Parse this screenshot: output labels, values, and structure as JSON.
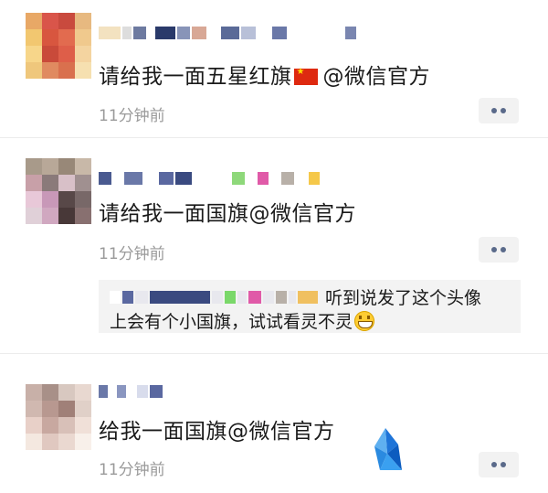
{
  "posts": [
    {
      "content": "请给我一面五星红旗",
      "mention": "@微信官方",
      "time": "11分钟前"
    },
    {
      "content": "请给我一面国旗@微信官方",
      "time": "11分钟前",
      "comment": {
        "line1": "听到说发了这个头像",
        "line2": "上会有个小国旗，试试看灵不灵"
      }
    },
    {
      "content": "给我一面国旗@微信官方",
      "time": "11分钟前"
    }
  ],
  "icons": {
    "flag": "china-flag-emoji",
    "grin": "grinning-face-emoji",
    "more": "more-dots-icon",
    "watermark": "blue-crystal-logo"
  },
  "colors": {
    "text": "#1a1a1a",
    "time": "#9a9a9a",
    "more_dots": "#5a6a8a",
    "comment_bg": "#f3f3f3"
  }
}
